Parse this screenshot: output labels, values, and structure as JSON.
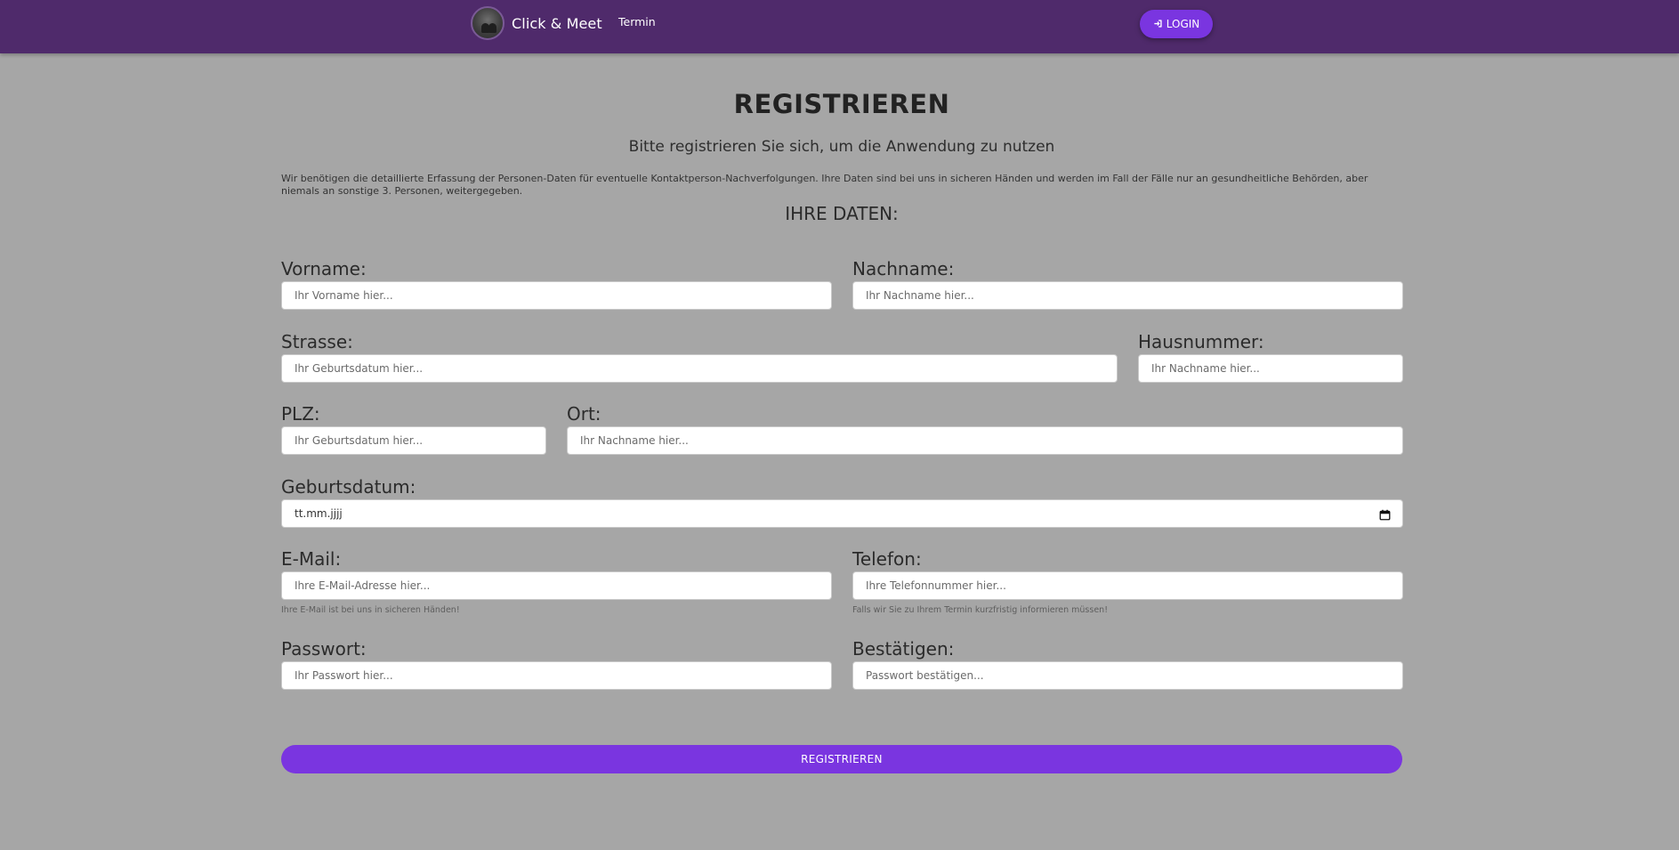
{
  "navbar": {
    "brand_name": "Click & Meet",
    "logo_icon": "people-logo-icon",
    "links": [
      {
        "label": "Termin"
      }
    ],
    "login_label": "LOGIN",
    "login_icon": "sign-in-icon",
    "background": "#4f2a6b",
    "accent": "#7a35e0"
  },
  "page": {
    "title": "REGISTRIEREN",
    "subtitle": "Bitte registrieren Sie sich, um die Anwendung zu nutzen",
    "info_text": "Wir benötigen die detaillierte Erfassung der Personen-Daten für eventuelle Kontaktperson-Nachverfolgungen. Ihre Daten sind bei uns in sicheren Händen und werden im Fall der Fälle nur an gesundheitliche Behörden, aber niemals an sonstige 3. Personen, weitergegeben.",
    "section_title": "IHRE DATEN:"
  },
  "form": {
    "vorname": {
      "label": "Vorname:",
      "placeholder": "Ihr Vorname hier..."
    },
    "nachname": {
      "label": "Nachname:",
      "placeholder": "Ihr Nachname hier..."
    },
    "strasse": {
      "label": "Strasse:",
      "placeholder": "Ihr Geburtsdatum hier..."
    },
    "hausnummer": {
      "label": "Hausnummer:",
      "placeholder": "Ihr Nachname hier..."
    },
    "plz": {
      "label": "PLZ:",
      "placeholder": "Ihr Geburtsdatum hier..."
    },
    "ort": {
      "label": "Ort:",
      "placeholder": "Ihr Nachname hier..."
    },
    "geburtsdatum": {
      "label": "Geburtsdatum:",
      "value": "tt.mm.jjjj",
      "icon": "calendar-icon"
    },
    "email": {
      "label": "E-Mail:",
      "placeholder": "Ihre E-Mail-Adresse hier...",
      "help": "Ihre E-Mail ist bei uns in sicheren Händen!"
    },
    "telefon": {
      "label": "Telefon:",
      "placeholder": "Ihre Telefonnummer hier...",
      "help": "Falls wir Sie zu Ihrem Termin kurzfristig informieren müssen!"
    },
    "passwort": {
      "label": "Passwort:",
      "placeholder": "Ihr Passwort hier..."
    },
    "bestaetigen": {
      "label": "Bestätigen:",
      "placeholder": "Passwort bestätigen..."
    },
    "submit_label": "REGISTRIEREN"
  }
}
